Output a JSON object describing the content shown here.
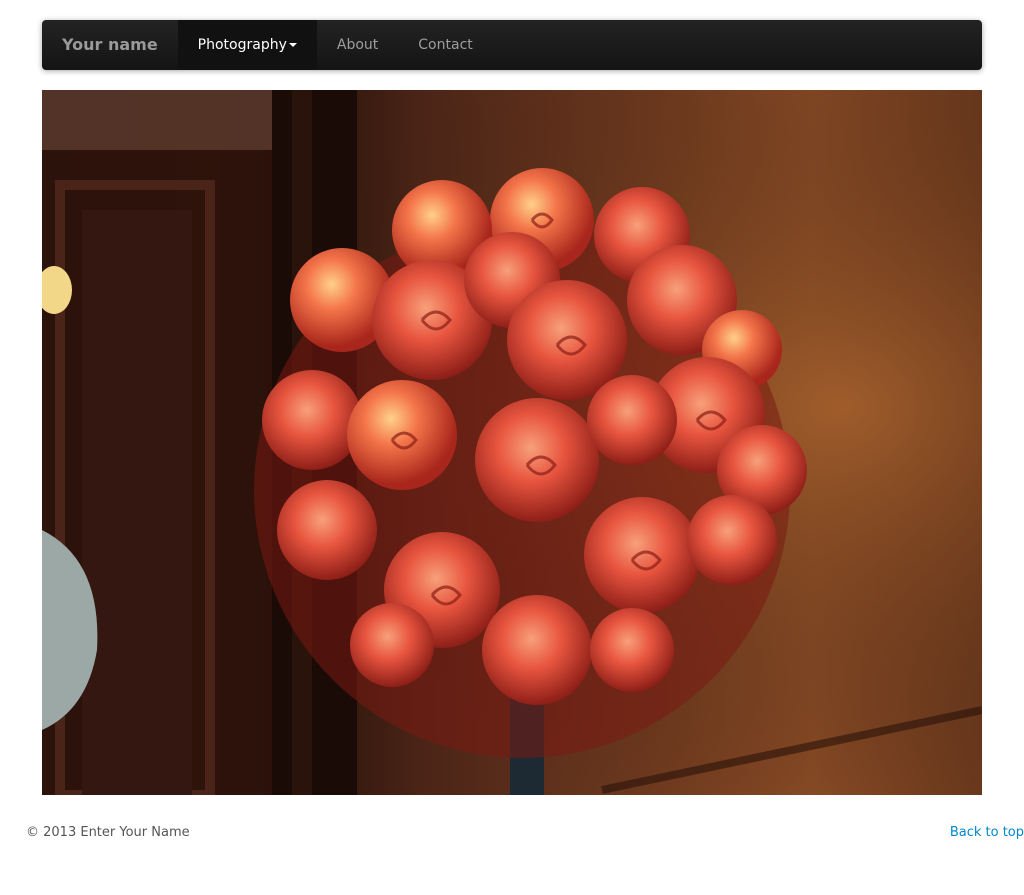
{
  "navbar": {
    "brand": "Your name",
    "items": [
      {
        "label": "Photography",
        "active": true,
        "dropdown": true
      },
      {
        "label": "About",
        "active": false,
        "dropdown": false
      },
      {
        "label": "Contact",
        "active": false,
        "dropdown": false
      }
    ]
  },
  "photo": {
    "subject": "bouquet of orange-pink roses"
  },
  "footer": {
    "copyright": "© 2013 Enter Your Name",
    "back_to_top": "Back to top"
  },
  "colors": {
    "navbar_bg": "#1b1b1b",
    "link": "#0088cc",
    "rose": "#e8553f"
  }
}
